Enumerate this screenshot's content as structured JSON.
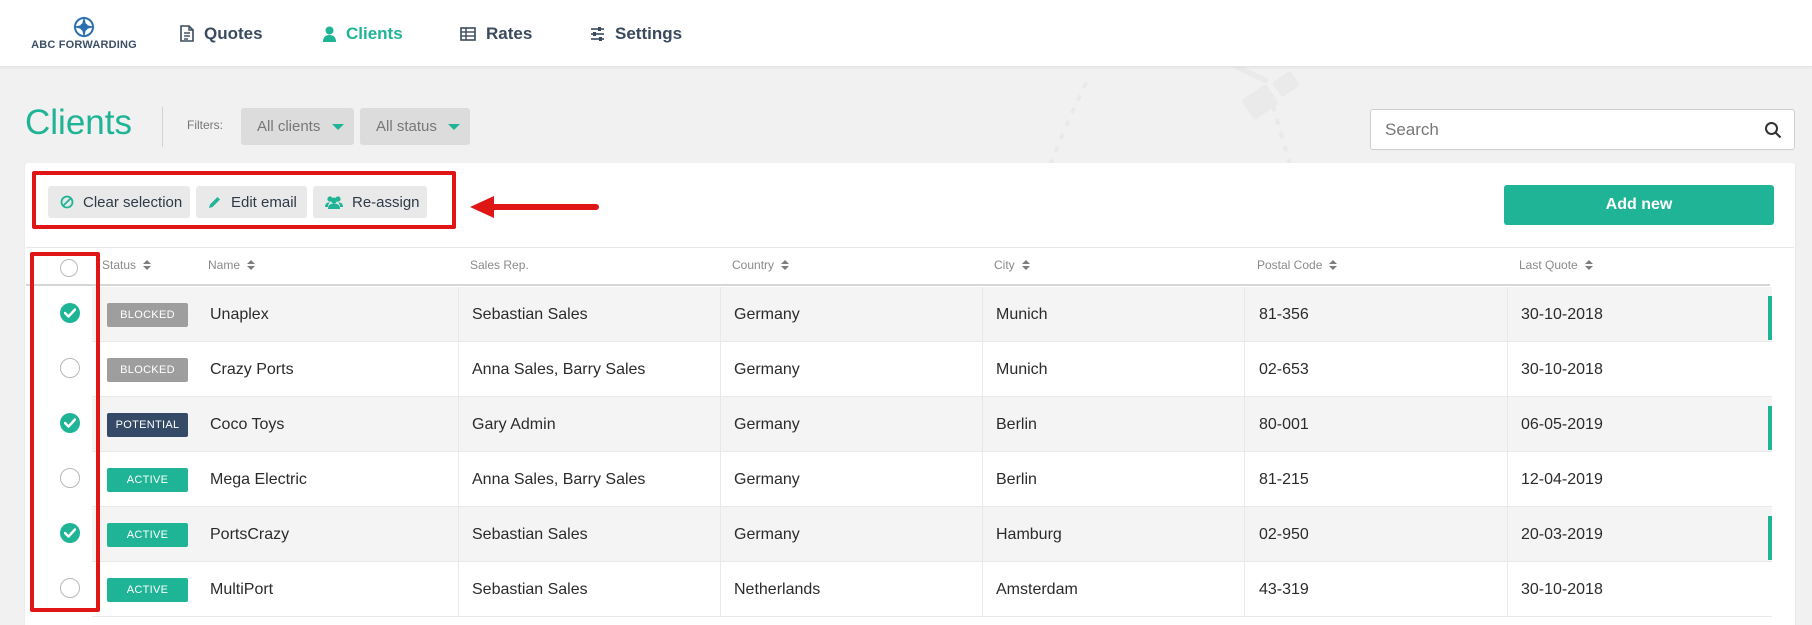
{
  "app": {
    "logo_text": "ABC FORWARDING",
    "nav": [
      {
        "label": "Quotes",
        "icon": "document-icon",
        "active": false
      },
      {
        "label": "Clients",
        "icon": "user-icon",
        "active": true
      },
      {
        "label": "Rates",
        "icon": "table-icon",
        "active": false
      },
      {
        "label": "Settings",
        "icon": "sliders-icon",
        "active": false
      }
    ]
  },
  "page": {
    "title": "Clients",
    "filters_label": "Filters:",
    "filters": [
      {
        "value": "All clients"
      },
      {
        "value": "All status"
      }
    ],
    "search": {
      "placeholder": "Search",
      "value": ""
    }
  },
  "toolbar": {
    "clear_selection": "Clear selection",
    "edit_email": "Edit email",
    "reassign": "Re-assign",
    "add_new": "Add new"
  },
  "table": {
    "headers": {
      "status": "Status",
      "name": "Name",
      "sales_rep": "Sales Rep.",
      "country": "Country",
      "city": "City",
      "postal_code": "Postal Code",
      "last_quote": "Last Quote"
    },
    "rows": [
      {
        "selected": true,
        "status": "BLOCKED",
        "name": "Unaplex",
        "sales_rep": "Sebastian Sales",
        "country": "Germany",
        "city": "Munich",
        "postal_code": "81-356",
        "last_quote": "30-10-2018"
      },
      {
        "selected": false,
        "status": "BLOCKED",
        "name": "Crazy Ports",
        "sales_rep": "Anna Sales, Barry Sales",
        "country": "Germany",
        "city": "Munich",
        "postal_code": "02-653",
        "last_quote": "30-10-2018"
      },
      {
        "selected": true,
        "status": "POTENTIAL",
        "name": "Coco Toys",
        "sales_rep": "Gary Admin",
        "country": "Germany",
        "city": "Berlin",
        "postal_code": "80-001",
        "last_quote": "06-05-2019"
      },
      {
        "selected": false,
        "status": "ACTIVE",
        "name": "Mega Electric",
        "sales_rep": "Anna Sales, Barry Sales",
        "country": "Germany",
        "city": "Berlin",
        "postal_code": "81-215",
        "last_quote": "12-04-2019"
      },
      {
        "selected": true,
        "status": "ACTIVE",
        "name": "PortsCrazy",
        "sales_rep": "Sebastian Sales",
        "country": "Germany",
        "city": "Hamburg",
        "postal_code": "02-950",
        "last_quote": "20-03-2019"
      },
      {
        "selected": false,
        "status": "ACTIVE",
        "name": "MultiPort",
        "sales_rep": "Sebastian Sales",
        "country": "Netherlands",
        "city": "Amsterdam",
        "postal_code": "43-319",
        "last_quote": "30-10-2018"
      }
    ]
  },
  "colors": {
    "accent": "#1fb495",
    "blocked": "#9e9e9e",
    "potential": "#354a66",
    "active": "#1fb495",
    "annotation": "#e01616"
  }
}
